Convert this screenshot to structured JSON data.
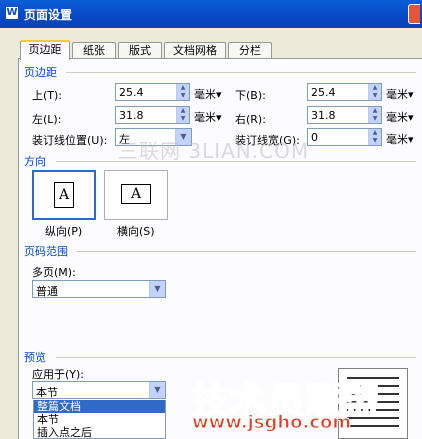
{
  "window": {
    "title": "页面设置"
  },
  "tabs": [
    "页边距",
    "纸张",
    "版式",
    "文档网格",
    "分栏"
  ],
  "margins": {
    "group": "页边距",
    "top": {
      "label": "上(T):",
      "value": "25.4"
    },
    "bottom": {
      "label": "下(B):",
      "value": "25.4"
    },
    "left": {
      "label": "左(L):",
      "value": "31.8"
    },
    "right": {
      "label": "右(R):",
      "value": "31.8"
    },
    "gutter_pos": {
      "label": "装订线位置(U):",
      "value": "左"
    },
    "gutter": {
      "label": "装订线宽(G):",
      "value": "0"
    },
    "unit": "毫米▾"
  },
  "orientation": {
    "group": "方向",
    "portrait": "纵向(P)",
    "landscape": "横向(S)",
    "glyph": "A"
  },
  "pages": {
    "group": "页码范围",
    "label": "多页(M):",
    "value": "普通"
  },
  "preview": {
    "group": "预览",
    "apply_label": "应用于(Y):",
    "apply_value": "本节",
    "options": [
      "整篇文档",
      "本节",
      "插入点之后"
    ]
  },
  "watermarks": {
    "site": "三联网 3LIAN.COM",
    "brand": "技术员联盟",
    "url": "www.jsgho.com"
  },
  "colors": {
    "accent": "#316AC5",
    "group_label": "#0046D5",
    "titlebar": "#0A5FD8"
  }
}
